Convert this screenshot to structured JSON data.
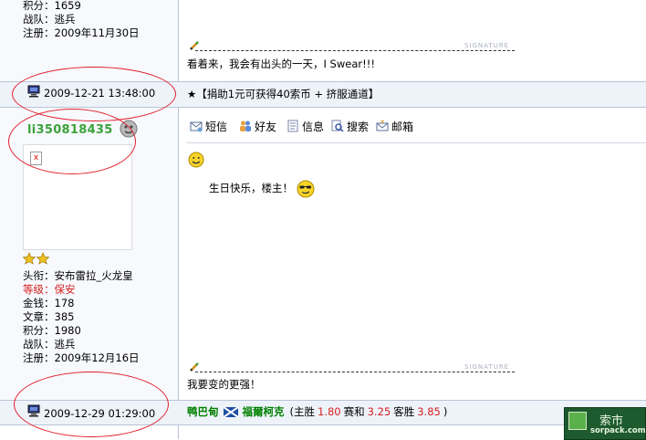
{
  "user1": {
    "points_label": "积分：",
    "points": "1659",
    "team_label": "战队：",
    "team": "逃兵",
    "reg_label": "注册：",
    "reg_date": "2009年11月30日"
  },
  "post1": {
    "signature_tag": "SIGNATURE",
    "signature": "看着来，我会有出头的一天，I Swear!!!"
  },
  "post2": {
    "time": "2009-12-21 13:48:00",
    "announcement": "★【捐助1元可获得40索币 + 挤服通道】",
    "username": "li350818435",
    "rank": "安布雷拉_火龙皇",
    "level": "保安",
    "money": "178",
    "articles": "385",
    "points": "1980",
    "team": "逃兵",
    "reg_date": "2009年12月16日",
    "labels": {
      "rank": "头衔：",
      "level": "等级：",
      "money": "金钱：",
      "articles": "文章：",
      "points": "积分：",
      "team": "战队：",
      "reg": "注册："
    },
    "toolbar": [
      "短信",
      "好友",
      "信息",
      "搜索",
      "邮箱"
    ],
    "body": "生日快乐，楼主！",
    "signature_tag": "SIGNATURE",
    "signature": "我要变的更强！"
  },
  "post3": {
    "time": "2009-12-29 01:29:00",
    "team_home": "鸭巴甸",
    "team_away": "福爾柯克",
    "odds_open": "(主胜",
    "home_win": "1.80",
    "draw_label": "赛和",
    "draw": "3.25",
    "away_label": "客胜",
    "away_win": "3.85",
    "odds_close": ")"
  },
  "watermark": {
    "text": "索市",
    "site": "sorpack.com"
  },
  "colors": {
    "username": "#3aa33a",
    "level": "#d42020",
    "odds_num": "#d42020",
    "team": "#008000",
    "annotation": "#e21e2b"
  }
}
